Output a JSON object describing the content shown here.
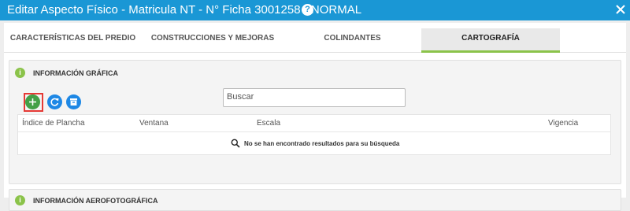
{
  "window": {
    "title": "Editar Aspecto Físico - Matricula NT - N° Ficha 3001258 - NORMAL",
    "help_label": "?"
  },
  "tabs": [
    {
      "label": "CARACTERÍSTICAS DEL PREDIO",
      "active": false
    },
    {
      "label": "CONSTRUCCIONES Y MEJORAS",
      "active": false
    },
    {
      "label": "COLINDANTES",
      "active": false
    },
    {
      "label": "CARTOGRAFÍA",
      "active": true
    }
  ],
  "graphic_info": {
    "title": "INFORMACIÓN GRÁFICA",
    "info_badge": "i",
    "search_placeholder": "Buscar",
    "columns": [
      "Índice de Plancha",
      "Ventana",
      "Escala",
      "Vigencia"
    ],
    "empty_message": "No se han encontrado resultados para su búsqueda"
  },
  "aerial_info": {
    "title": "INFORMACIÓN AEROFOTOGRÁFICA",
    "info_badge": "i"
  },
  "colors": {
    "titlebar": "#1a97d5",
    "accent_green": "#8bc34a",
    "add_button": "#43a047",
    "action_blue": "#1e88e5",
    "highlight_red": "#e53935"
  },
  "icons": {
    "help": "help-icon",
    "close": "close-icon",
    "add": "plus-icon",
    "refresh": "refresh-icon",
    "archive": "archive-icon",
    "search": "search-icon",
    "info": "info-icon"
  }
}
